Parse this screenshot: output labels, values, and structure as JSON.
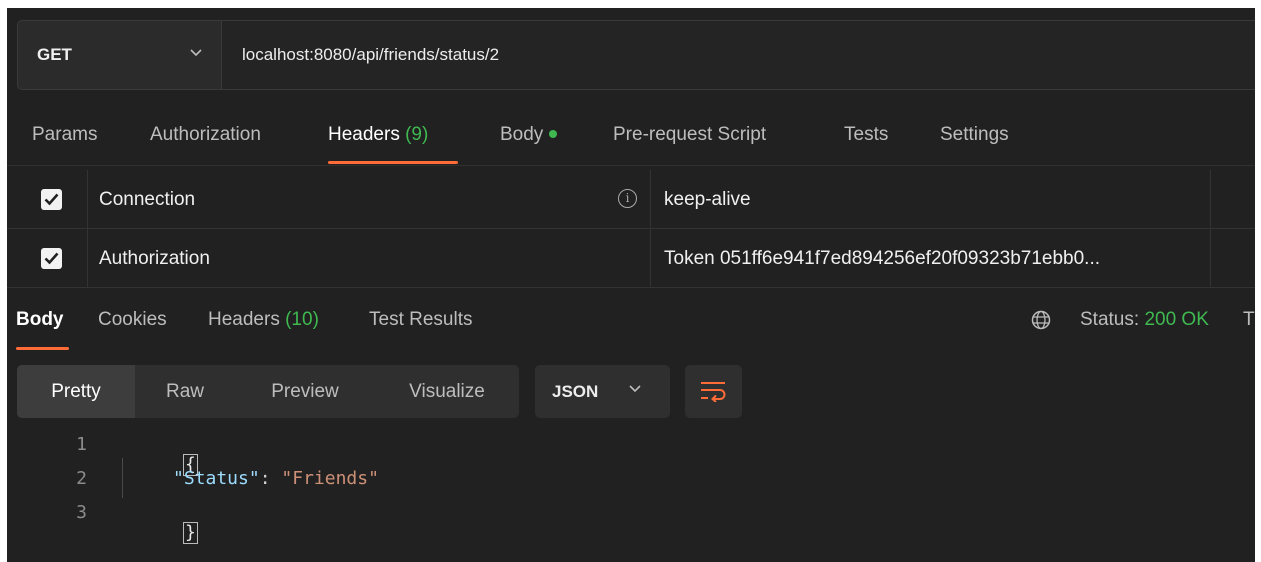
{
  "request": {
    "method": "GET",
    "url": "localhost:8080/api/friends/status/2"
  },
  "request_tabs": [
    {
      "label": "Params"
    },
    {
      "label": "Authorization"
    },
    {
      "label": "Headers",
      "count": "(9)",
      "active": true
    },
    {
      "label": "Body",
      "dot": true
    },
    {
      "label": "Pre-request Script"
    },
    {
      "label": "Tests"
    },
    {
      "label": "Settings"
    }
  ],
  "headers": [
    {
      "checked": true,
      "key": "Connection",
      "info_icon": true,
      "value": "keep-alive"
    },
    {
      "checked": true,
      "key": "Authorization",
      "value": "Token 051ff6e941f7ed894256ef20f09323b71ebb0..."
    }
  ],
  "response_tabs": [
    {
      "label": "Body",
      "active": true
    },
    {
      "label": "Cookies"
    },
    {
      "label": "Headers",
      "count": "(10)"
    },
    {
      "label": "Test Results"
    }
  ],
  "response_status": {
    "label": "Status:",
    "value": "200 OK",
    "truncated_next": "T"
  },
  "format_tabs": [
    {
      "label": "Pretty",
      "active": true
    },
    {
      "label": "Raw"
    },
    {
      "label": "Preview"
    },
    {
      "label": "Visualize"
    }
  ],
  "language_select": {
    "value": "JSON"
  },
  "code_lines": [
    {
      "number": "1",
      "open": "{"
    },
    {
      "number": "2",
      "key": "\"Status\"",
      "colon": ": ",
      "value": "\"Friends\""
    },
    {
      "number": "3",
      "close": "}"
    }
  ],
  "colors": {
    "accent": "#ff6c37",
    "success": "#3fb950",
    "background": "#212121"
  },
  "icons": {
    "method_dropdown": "chevron-down-icon",
    "info": "info-icon",
    "checkbox": "check-icon",
    "globe": "globe-icon",
    "language_dropdown": "chevron-down-icon",
    "wrap": "wrap-lines-icon"
  }
}
